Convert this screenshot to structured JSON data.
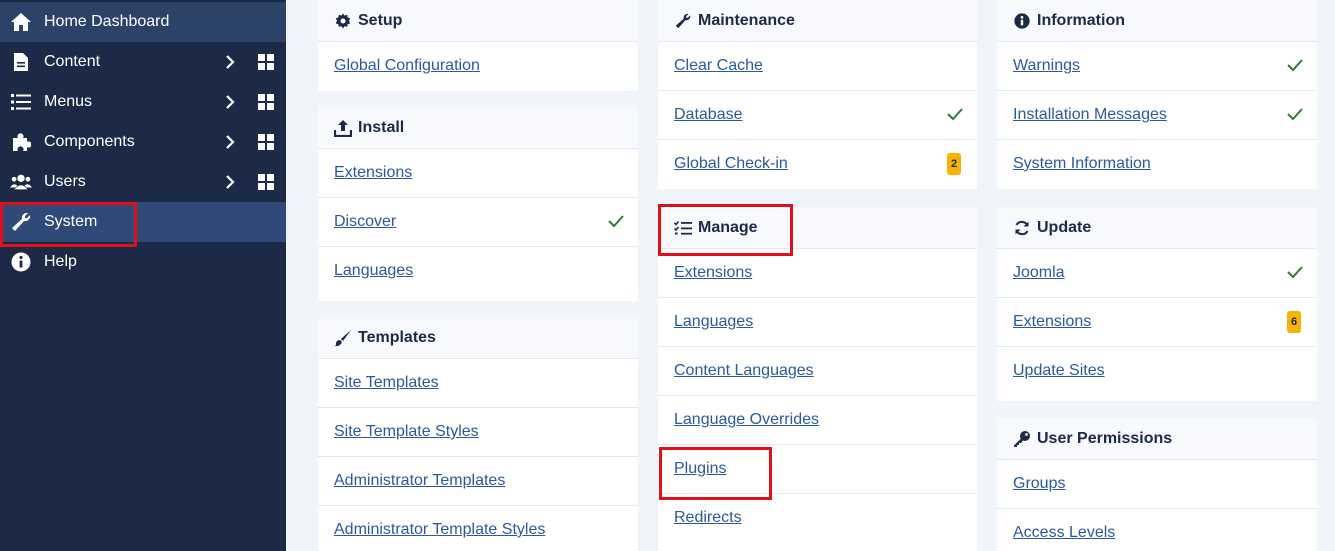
{
  "sidebar": {
    "items": [
      {
        "label": "Home Dashboard",
        "icon": "home-icon"
      },
      {
        "label": "Content",
        "icon": "file-icon"
      },
      {
        "label": "Menus",
        "icon": "list-icon"
      },
      {
        "label": "Components",
        "icon": "puzzle-icon"
      },
      {
        "label": "Users",
        "icon": "users-icon"
      },
      {
        "label": "System",
        "icon": "wrench-icon"
      },
      {
        "label": "Help",
        "icon": "info-icon"
      }
    ]
  },
  "setup": {
    "title": "Setup",
    "links": [
      "Global Configuration"
    ]
  },
  "install": {
    "title": "Install",
    "links": [
      "Extensions",
      "Discover",
      "Languages"
    ]
  },
  "templates": {
    "title": "Templates",
    "links": [
      "Site Templates",
      "Site Template Styles",
      "Administrator Templates",
      "Administrator Template Styles"
    ]
  },
  "maintenance": {
    "title": "Maintenance",
    "links": [
      "Clear Cache",
      "Database",
      "Global Check-in"
    ],
    "checkin_badge": "2"
  },
  "manage": {
    "title": "Manage",
    "links": [
      "Extensions",
      "Languages",
      "Content Languages",
      "Language Overrides",
      "Plugins",
      "Redirects"
    ]
  },
  "information": {
    "title": "Information",
    "links": [
      "Warnings",
      "Installation Messages",
      "System Information"
    ]
  },
  "update": {
    "title": "Update",
    "links": [
      "Joomla",
      "Extensions",
      "Update Sites"
    ],
    "extensions_badge": "6"
  },
  "permissions": {
    "title": "User Permissions",
    "links": [
      "Groups",
      "Access Levels"
    ]
  },
  "colors": {
    "sidebar": "#1c2a48",
    "link": "#2a5a9c",
    "check": "#2f7d32",
    "badge": "#f5b400",
    "highlight": "#e0101a"
  }
}
